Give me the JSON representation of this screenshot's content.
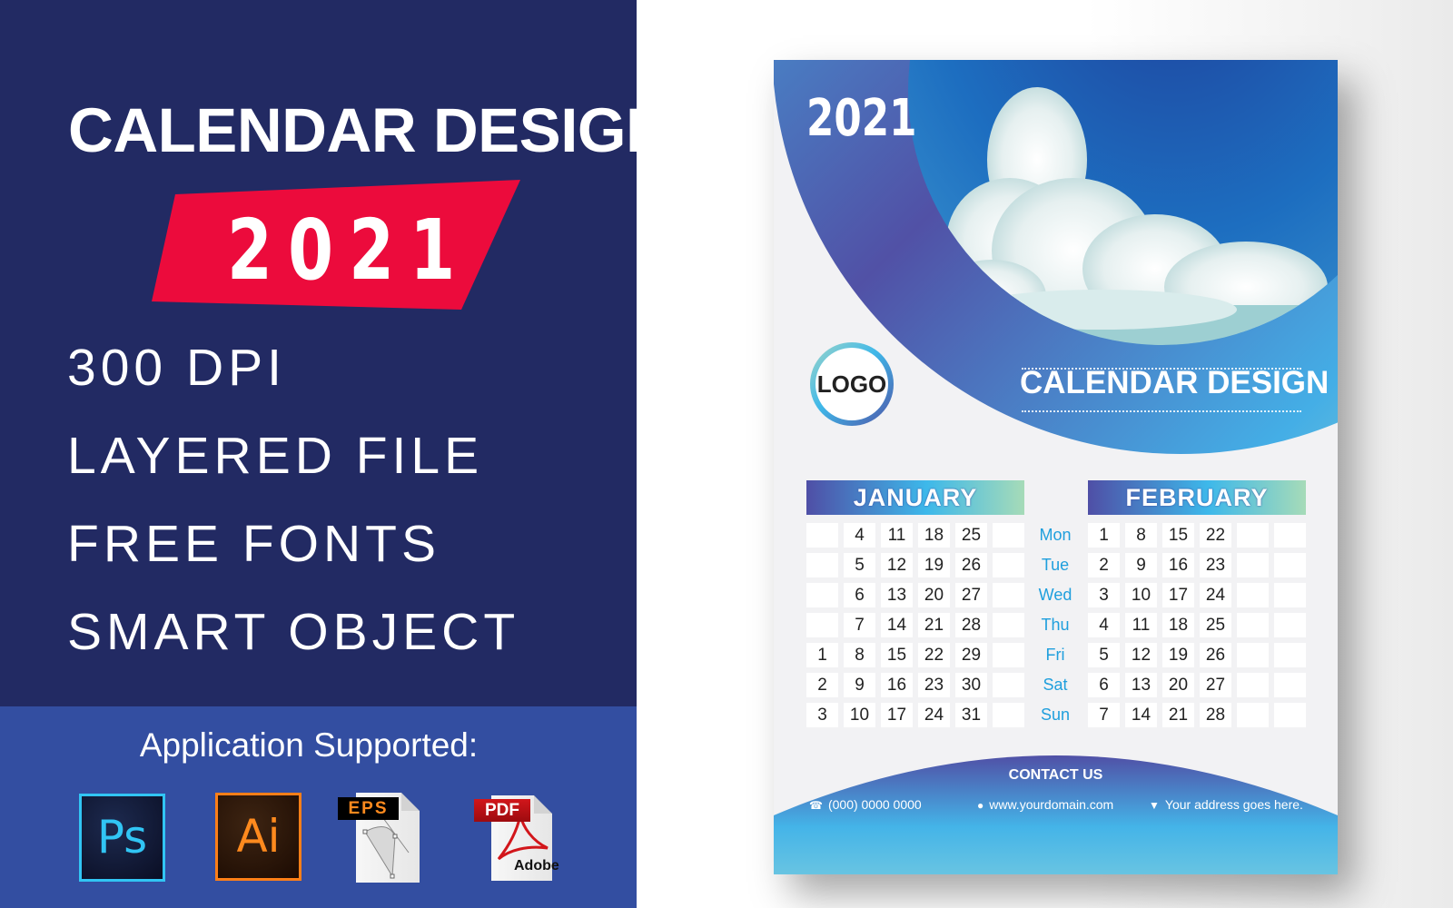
{
  "promo": {
    "title": "CALENDAR DESIGN",
    "year": "2021",
    "features": [
      "300 DPI",
      "LAYERED FILE",
      "FREE FONTS",
      "SMART OBJECT"
    ],
    "apps_label": "Application Supported:",
    "apps": [
      {
        "icon": "photoshop-icon",
        "label": "Ps"
      },
      {
        "icon": "illustrator-icon",
        "label": "Ai"
      },
      {
        "icon": "eps-file-icon",
        "label": "EPS"
      },
      {
        "icon": "pdf-file-icon",
        "label": "PDF",
        "sublabel": "Adobe"
      }
    ],
    "colors": {
      "panel": "#222a63",
      "band": "#334ea1",
      "badge": "#ec0b3c"
    }
  },
  "calendar": {
    "year": "2021",
    "logo_text": "LOGO",
    "title": "CALENDAR DESIGN",
    "weekdays": [
      "Mon",
      "Tue",
      "Wed",
      "Thu",
      "Fri",
      "Sat",
      "Sun"
    ],
    "months": [
      {
        "name": "JANUARY",
        "rows": [
          [
            "",
            "4",
            "11",
            "18",
            "25",
            ""
          ],
          [
            "",
            "5",
            "12",
            "19",
            "26",
            ""
          ],
          [
            "",
            "6",
            "13",
            "20",
            "27",
            ""
          ],
          [
            "",
            "7",
            "14",
            "21",
            "28",
            ""
          ],
          [
            "1",
            "8",
            "15",
            "22",
            "29",
            ""
          ],
          [
            "2",
            "9",
            "16",
            "23",
            "30",
            ""
          ],
          [
            "3",
            "10",
            "17",
            "24",
            "31",
            ""
          ]
        ]
      },
      {
        "name": "FEBRUARY",
        "rows": [
          [
            "1",
            "8",
            "15",
            "22",
            "",
            ""
          ],
          [
            "2",
            "9",
            "16",
            "23",
            "",
            ""
          ],
          [
            "3",
            "10",
            "17",
            "24",
            "",
            ""
          ],
          [
            "4",
            "11",
            "18",
            "25",
            "",
            ""
          ],
          [
            "5",
            "12",
            "19",
            "26",
            "",
            ""
          ],
          [
            "6",
            "13",
            "20",
            "27",
            "",
            ""
          ],
          [
            "7",
            "14",
            "21",
            "28",
            "",
            ""
          ]
        ]
      }
    ],
    "contact": {
      "title": "CONTACT US",
      "phone": "(000) 0000 0000",
      "website": "www.yourdomain.com",
      "address": "Your address goes here."
    },
    "colors": {
      "accent": "#4f55a8",
      "sky": "#3fb8e9",
      "weekday": "#1f9fdd"
    }
  }
}
